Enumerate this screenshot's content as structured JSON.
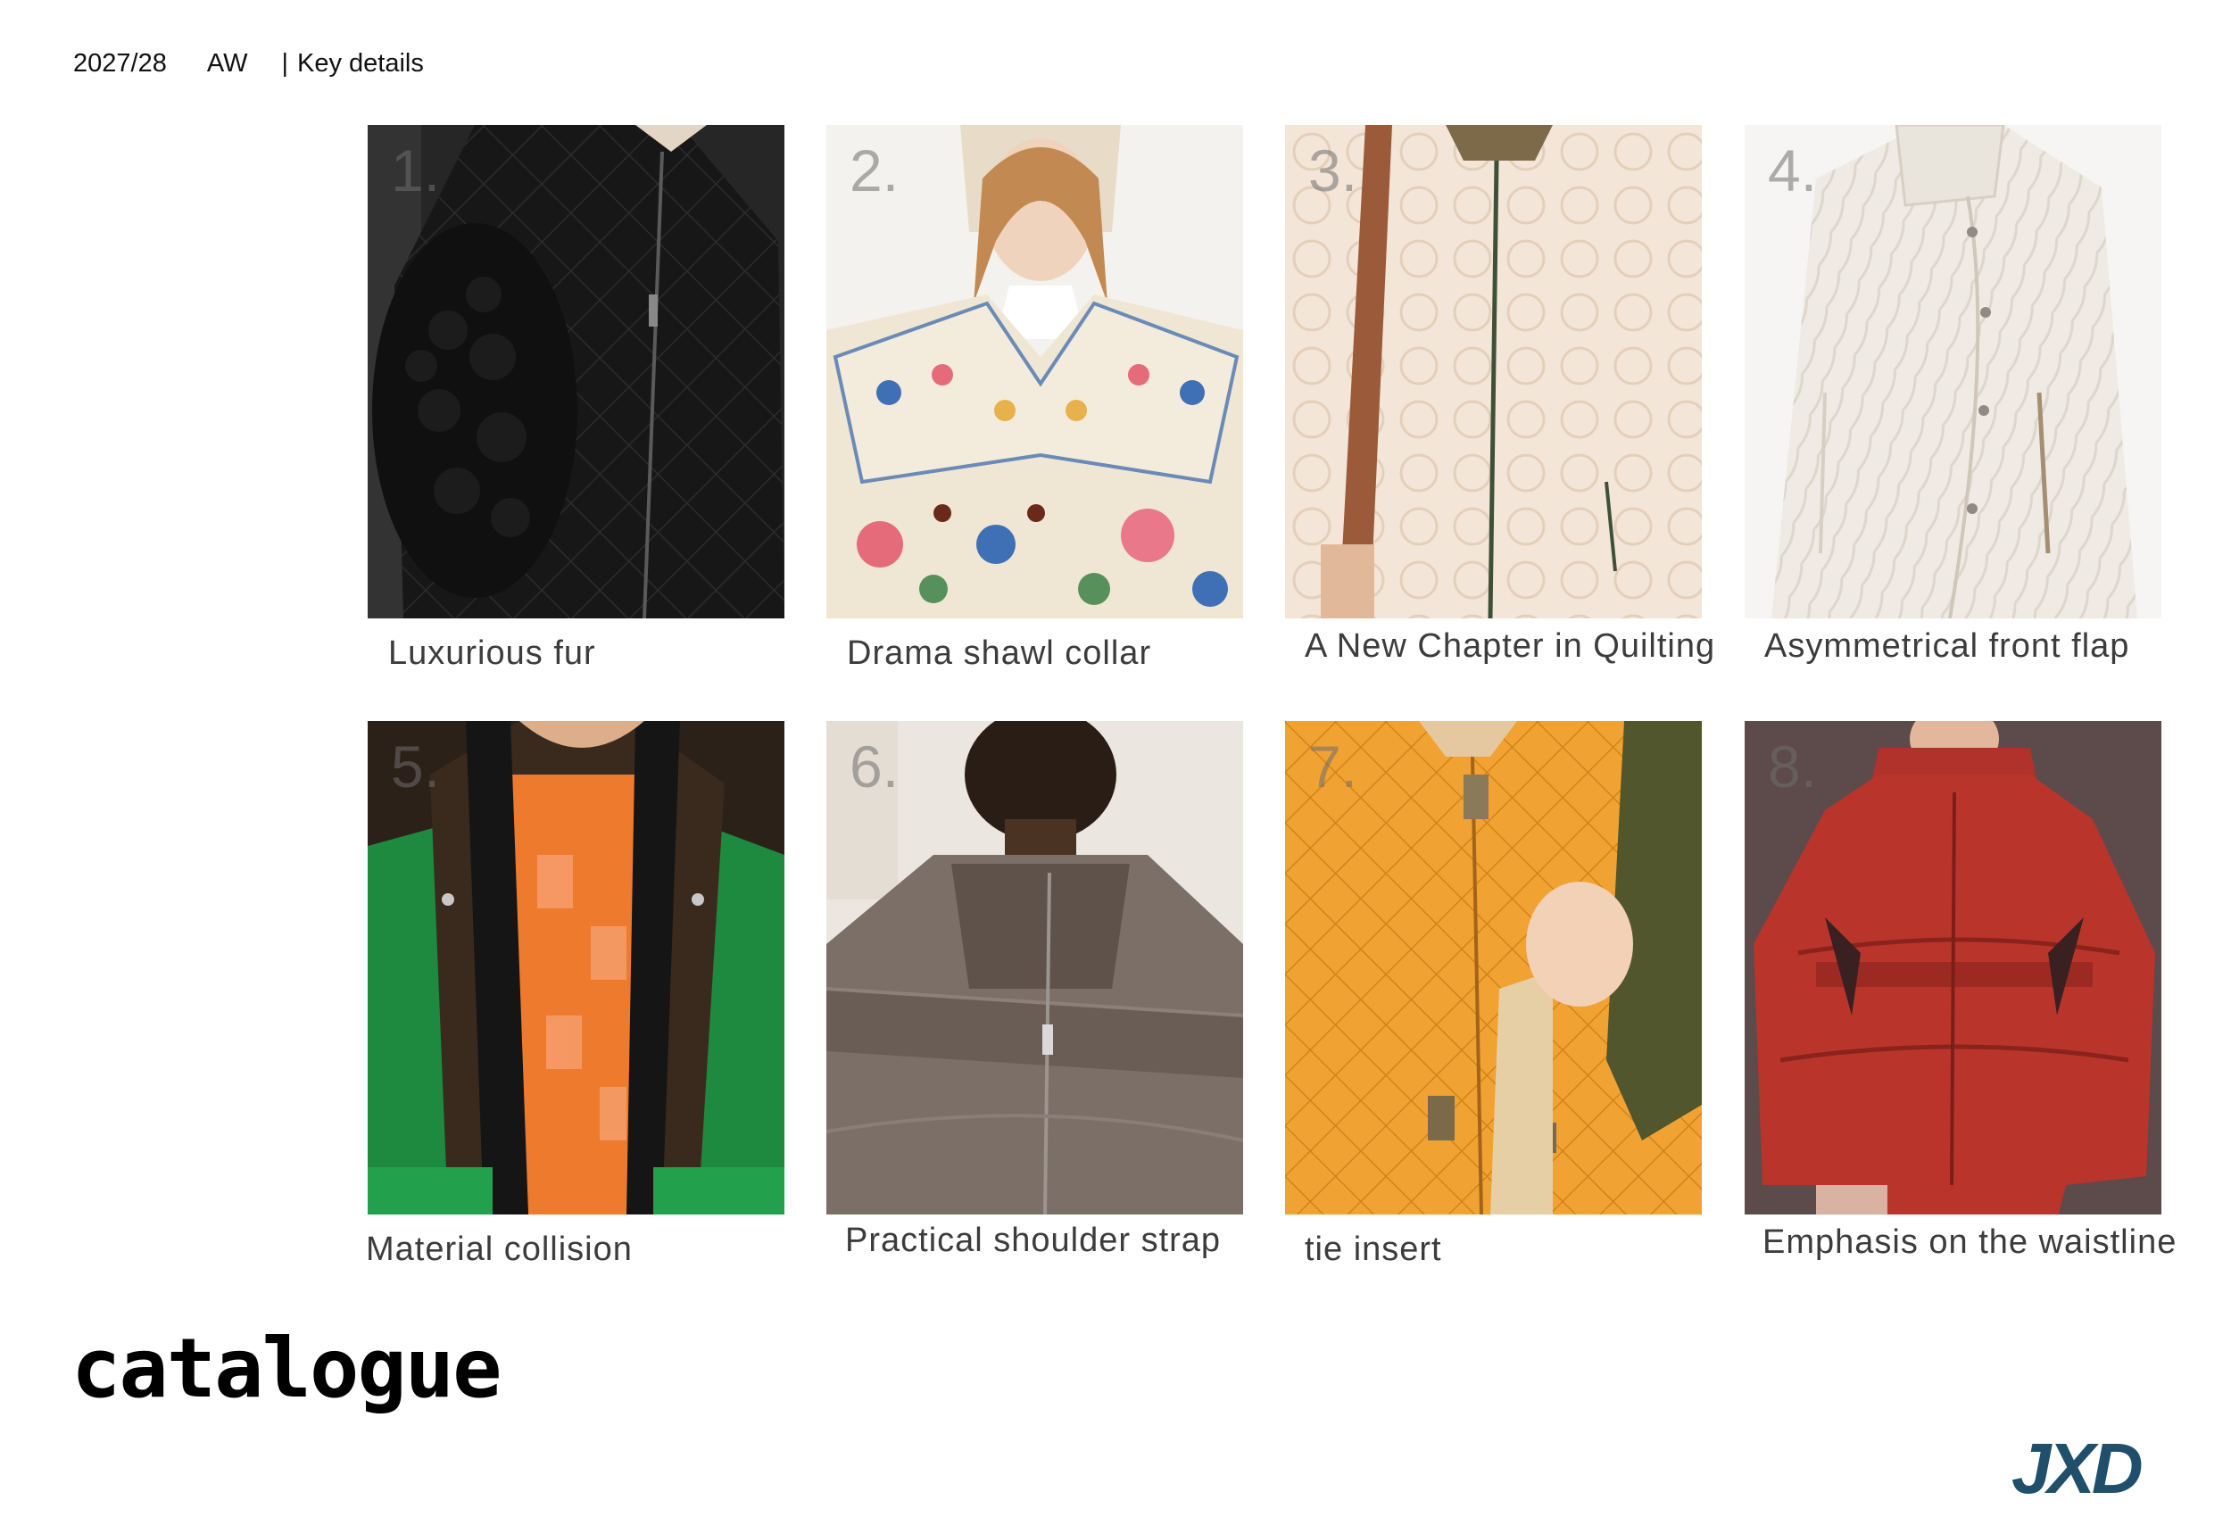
{
  "header": {
    "year": "2027/28",
    "season": "AW",
    "separator": "|",
    "section": "Key details"
  },
  "items": [
    {
      "number": "1.",
      "caption": "Luxurious fur",
      "icon": "black-quilted-jacket-with-fur-sleeve",
      "colors": {
        "bg": "#2a2a2a",
        "garment": "#151515"
      }
    },
    {
      "number": "2.",
      "caption": "Drama shawl collar",
      "icon": "floral-quilted-coat-with-shawl-collar",
      "colors": {
        "bg": "#f2f0ec",
        "garment": "#efe8d6"
      }
    },
    {
      "number": "3.",
      "caption": "A New Chapter in Quilting",
      "icon": "cream-quilted-jacket-with-strap",
      "colors": {
        "bg": "#efe2d4",
        "garment": "#f3e5d7"
      }
    },
    {
      "number": "4.",
      "caption": "Asymmetrical front flap",
      "icon": "white-quilted-asymmetric-coat",
      "colors": {
        "bg": "#f4f3f1",
        "garment": "#eeeae3"
      }
    },
    {
      "number": "5.",
      "caption": "Material collision",
      "icon": "green-brown-parka-orange-top",
      "colors": {
        "bg": "#2b2017",
        "garment": "#1f8a3e"
      }
    },
    {
      "number": "6.",
      "caption": "Practical shoulder strap",
      "icon": "taupe-puffer-with-strap",
      "colors": {
        "bg": "#e7e2dc",
        "garment": "#7d7068"
      }
    },
    {
      "number": "7.",
      "caption": "tie insert",
      "icon": "orange-quilted-leather-jacket",
      "colors": {
        "bg": "#e99526",
        "garment": "#f0a236"
      }
    },
    {
      "number": "8.",
      "caption": "Emphasis on the waistline",
      "icon": "red-belted-puffer-jacket",
      "colors": {
        "bg": "#5a4646",
        "garment": "#b9352b"
      }
    }
  ],
  "footer": {
    "title": "catalogue",
    "logo_text": "JXD",
    "logo_color": "#1f4f6b"
  }
}
